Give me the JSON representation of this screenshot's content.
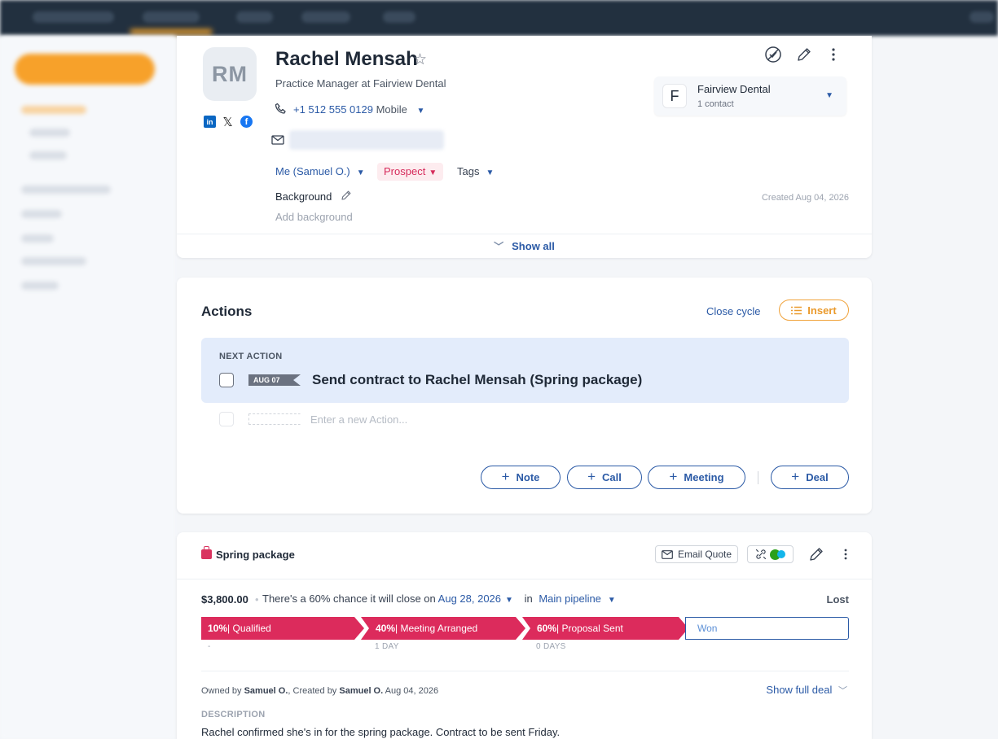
{
  "contact": {
    "initials": "RM",
    "name": "Rachel Mensah",
    "job_title": "Practice Manager at Fairview Dental",
    "phone": "+1 512 555 0129",
    "phone_type": "Mobile",
    "owner": "Me (Samuel O.)",
    "status": "Prospect",
    "tags_label": "Tags",
    "background_label": "Background",
    "background_placeholder": "Add background",
    "created": "Created Aug 04, 2026",
    "show_all": "Show all",
    "company": {
      "initial": "F",
      "name": "Fairview Dental",
      "count": "1 contact"
    },
    "social": {
      "linkedin": "in",
      "x": "𝕏",
      "facebook": "f"
    }
  },
  "actions": {
    "title": "Actions",
    "close_cycle": "Close cycle",
    "insert": "Insert",
    "next_label": "NEXT ACTION",
    "next_date": "AUG 07",
    "next_text": "Send contract to Rachel Mensah (Spring package)",
    "new_placeholder": "Enter a new Action...",
    "buttons": {
      "note": "Note",
      "call": "Call",
      "meeting": "Meeting",
      "deal": "Deal"
    }
  },
  "deal": {
    "title": "Spring package",
    "email_quote": "Email Quote",
    "amount": "$3,800.00",
    "chance_prefix": "There's a 60% chance it will close on",
    "close_date": "Aug 28, 2026",
    "in": "in",
    "pipeline": "Main pipeline",
    "lost": "Lost",
    "stages": [
      {
        "percent": "10%",
        "name": "Qualified",
        "duration": "-"
      },
      {
        "percent": "40%",
        "name": "Meeting Arranged",
        "duration": "1 DAY"
      },
      {
        "percent": "60%",
        "name": "Proposal Sent",
        "duration": "0 DAYS"
      }
    ],
    "won": "Won",
    "owned_prefix": "Owned by",
    "owned_by": "Samuel O.",
    "created_prefix": ", Created by",
    "created_by": "Samuel O.",
    "created_date": "Aug 04, 2026",
    "show_full": "Show full deal",
    "description_label": "DESCRIPTION",
    "description": "Rachel confirmed she's in for the spring package. Contract to be sent Friday."
  },
  "colors": {
    "accent_blue": "#2b5aa6",
    "stage_pink": "#dc2b5c",
    "insert_orange": "#f0a23a",
    "next_action_bg": "#e3ecfb"
  }
}
